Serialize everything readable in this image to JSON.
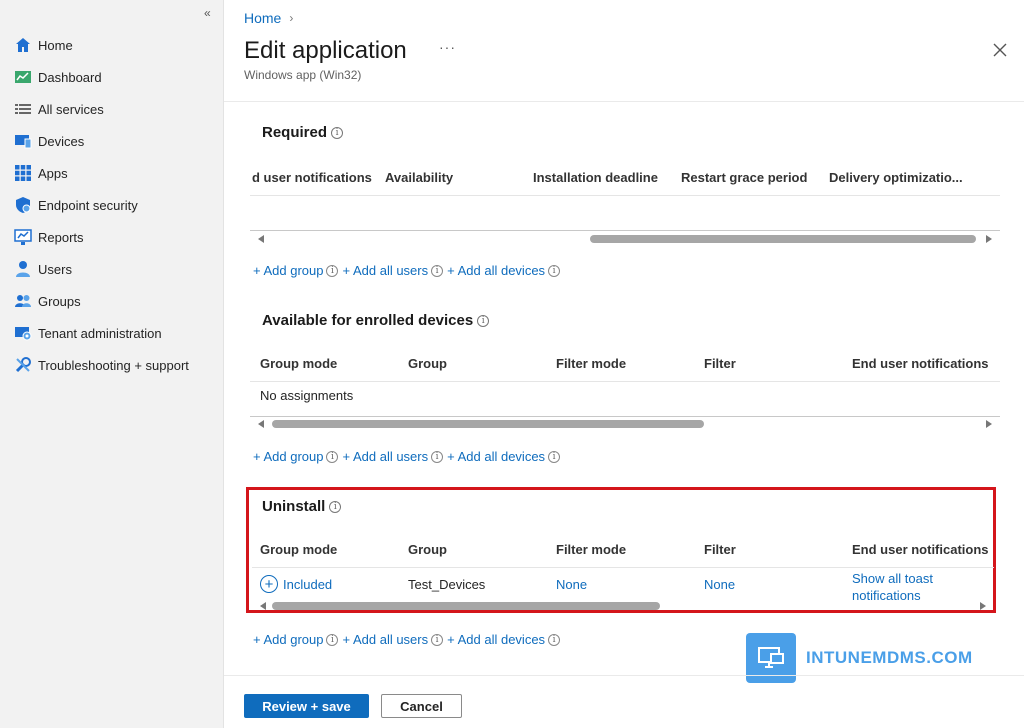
{
  "sidebar": {
    "items": [
      {
        "label": "Home",
        "icon": "home-icon"
      },
      {
        "label": "Dashboard",
        "icon": "dashboard-icon"
      },
      {
        "label": "All services",
        "icon": "list-icon"
      },
      {
        "label": "Devices",
        "icon": "devices-icon"
      },
      {
        "label": "Apps",
        "icon": "apps-icon"
      },
      {
        "label": "Endpoint security",
        "icon": "shield-icon"
      },
      {
        "label": "Reports",
        "icon": "reports-icon"
      },
      {
        "label": "Users",
        "icon": "user-icon"
      },
      {
        "label": "Groups",
        "icon": "groups-icon"
      },
      {
        "label": "Tenant administration",
        "icon": "tenant-icon"
      },
      {
        "label": "Troubleshooting + support",
        "icon": "wrench-icon"
      }
    ]
  },
  "header": {
    "breadcrumb": "Home",
    "title": "Edit application",
    "more": "···",
    "subtitle": "Windows app (Win32)"
  },
  "required": {
    "title": "Required",
    "columns": [
      "d user notifications",
      "Availability",
      "Installation deadline",
      "Restart grace period",
      "Delivery optimizatio..."
    ]
  },
  "available": {
    "title": "Available for enrolled devices",
    "columns": [
      "Group mode",
      "Group",
      "Filter mode",
      "Filter",
      "End user notifications"
    ],
    "empty": "No assignments"
  },
  "uninstall": {
    "title": "Uninstall",
    "columns": [
      "Group mode",
      "Group",
      "Filter mode",
      "Filter",
      "End user notifications"
    ],
    "row": {
      "group_mode": "Included",
      "group": "Test_Devices",
      "filter_mode": "None",
      "filter": "None",
      "notifications_line1": "Show all toast",
      "notifications_line2": "notifications"
    }
  },
  "add_links": {
    "add_group": "+ Add group",
    "add_all_users": "+ Add all users",
    "add_all_devices": "+ Add all devices"
  },
  "footer": {
    "review_save": "Review + save",
    "cancel": "Cancel"
  },
  "watermark": {
    "text": "INTUNEMDMS.COM"
  },
  "colors": {
    "accent": "#0f6cbd",
    "highlight": "#d4151b",
    "watermark": "#4a9fe8"
  }
}
